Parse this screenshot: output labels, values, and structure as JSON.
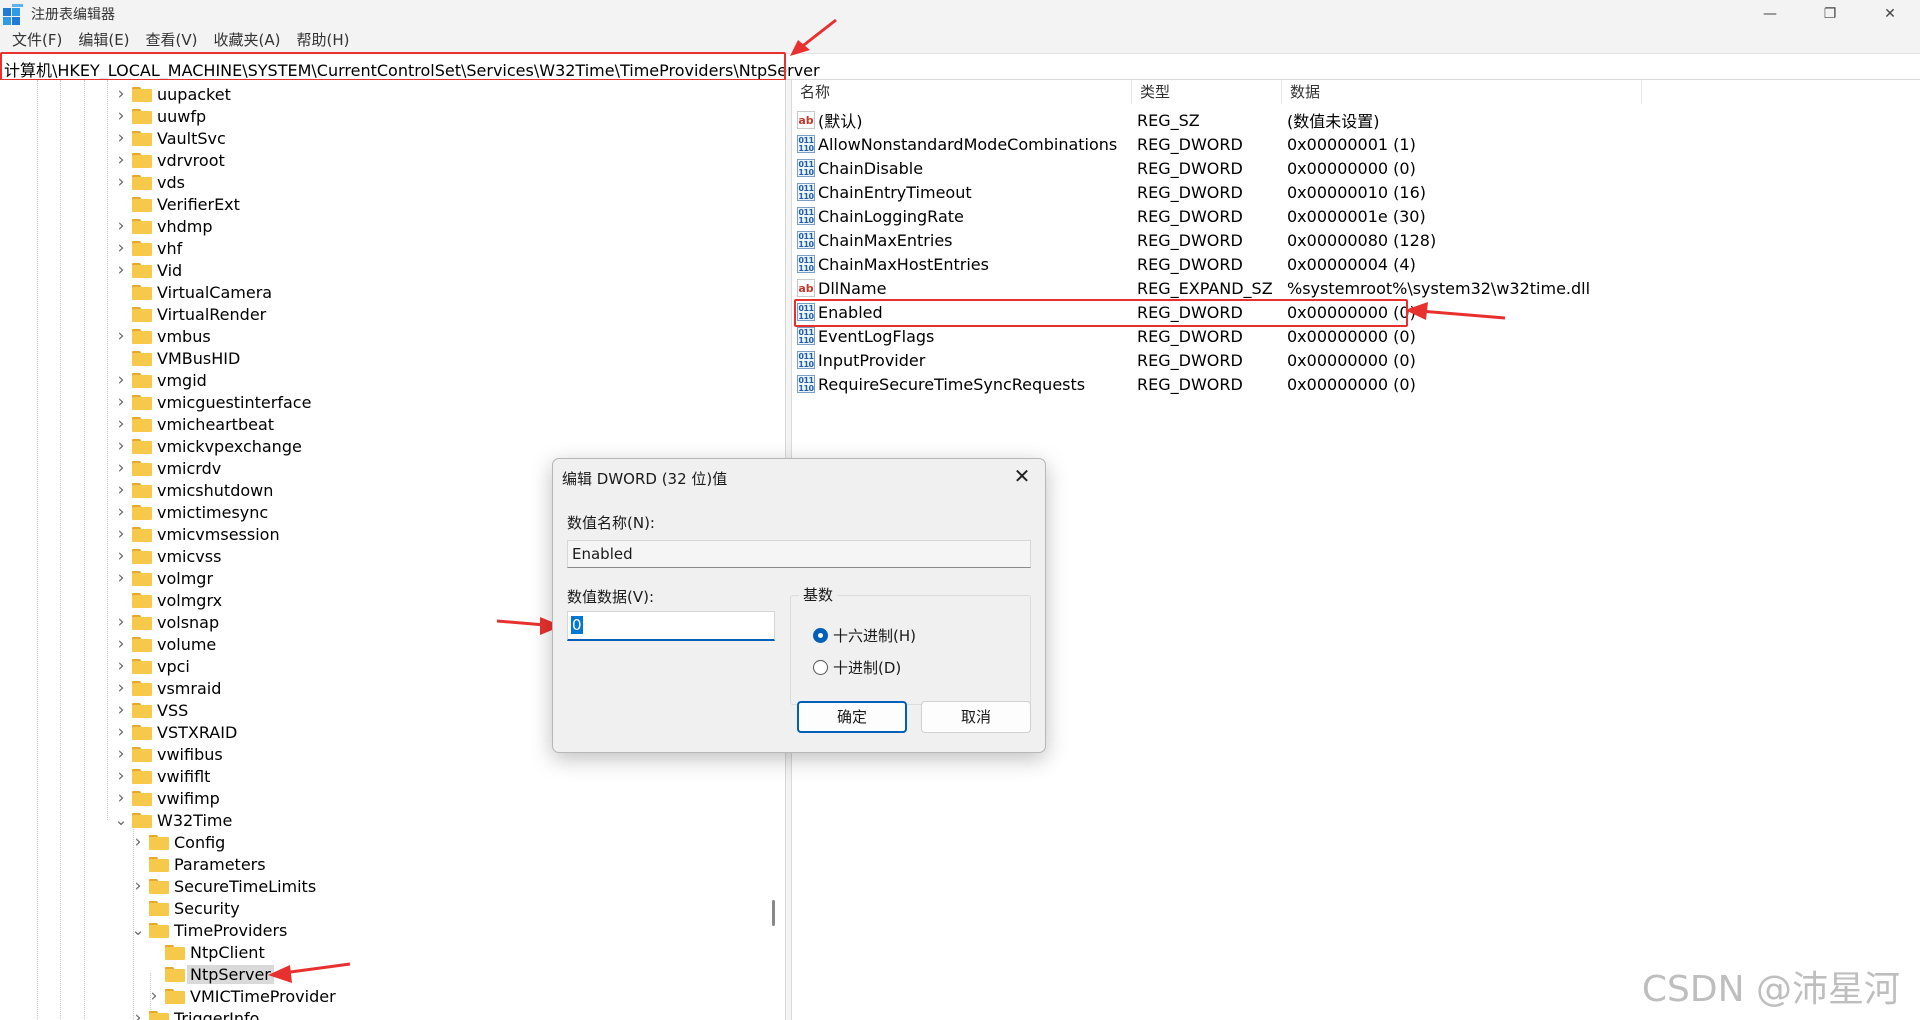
{
  "window": {
    "title": "注册表编辑器",
    "controls": {
      "minimize": "—",
      "restore": "❐",
      "close": "✕"
    }
  },
  "menu": [
    "文件(F)",
    "编辑(E)",
    "查看(V)",
    "收藏夹(A)",
    "帮助(H)"
  ],
  "address": "计算机\\HKEY_LOCAL_MACHINE\\SYSTEM\\CurrentControlSet\\Services\\W32Time\\TimeProviders\\NtpServer",
  "tree": {
    "items": [
      {
        "label": "uupacket",
        "level": 0,
        "expander": "collapsed"
      },
      {
        "label": "uuwfp",
        "level": 0,
        "expander": "collapsed"
      },
      {
        "label": "VaultSvc",
        "level": 0,
        "expander": "collapsed"
      },
      {
        "label": "vdrvroot",
        "level": 0,
        "expander": "collapsed"
      },
      {
        "label": "vds",
        "level": 0,
        "expander": "collapsed"
      },
      {
        "label": "VerifierExt",
        "level": 0,
        "expander": "none"
      },
      {
        "label": "vhdmp",
        "level": 0,
        "expander": "collapsed"
      },
      {
        "label": "vhf",
        "level": 0,
        "expander": "collapsed"
      },
      {
        "label": "Vid",
        "level": 0,
        "expander": "collapsed"
      },
      {
        "label": "VirtualCamera",
        "level": 0,
        "expander": "none"
      },
      {
        "label": "VirtualRender",
        "level": 0,
        "expander": "none"
      },
      {
        "label": "vmbus",
        "level": 0,
        "expander": "collapsed"
      },
      {
        "label": "VMBusHID",
        "level": 0,
        "expander": "none"
      },
      {
        "label": "vmgid",
        "level": 0,
        "expander": "collapsed"
      },
      {
        "label": "vmicguestinterface",
        "level": 0,
        "expander": "collapsed"
      },
      {
        "label": "vmicheartbeat",
        "level": 0,
        "expander": "collapsed"
      },
      {
        "label": "vmickvpexchange",
        "level": 0,
        "expander": "collapsed"
      },
      {
        "label": "vmicrdv",
        "level": 0,
        "expander": "collapsed"
      },
      {
        "label": "vmicshutdown",
        "level": 0,
        "expander": "collapsed"
      },
      {
        "label": "vmictimesync",
        "level": 0,
        "expander": "collapsed"
      },
      {
        "label": "vmicvmsession",
        "level": 0,
        "expander": "collapsed"
      },
      {
        "label": "vmicvss",
        "level": 0,
        "expander": "collapsed"
      },
      {
        "label": "volmgr",
        "level": 0,
        "expander": "collapsed"
      },
      {
        "label": "volmgrx",
        "level": 0,
        "expander": "none"
      },
      {
        "label": "volsnap",
        "level": 0,
        "expander": "collapsed"
      },
      {
        "label": "volume",
        "level": 0,
        "expander": "collapsed"
      },
      {
        "label": "vpci",
        "level": 0,
        "expander": "collapsed"
      },
      {
        "label": "vsmraid",
        "level": 0,
        "expander": "collapsed"
      },
      {
        "label": "VSS",
        "level": 0,
        "expander": "collapsed"
      },
      {
        "label": "VSTXRAID",
        "level": 0,
        "expander": "collapsed"
      },
      {
        "label": "vwifibus",
        "level": 0,
        "expander": "collapsed"
      },
      {
        "label": "vwififlt",
        "level": 0,
        "expander": "collapsed"
      },
      {
        "label": "vwifimp",
        "level": 0,
        "expander": "collapsed"
      },
      {
        "label": "W32Time",
        "level": 0,
        "expander": "expanded"
      },
      {
        "label": "Config",
        "level": 1,
        "expander": "collapsed"
      },
      {
        "label": "Parameters",
        "level": 1,
        "expander": "none"
      },
      {
        "label": "SecureTimeLimits",
        "level": 1,
        "expander": "collapsed"
      },
      {
        "label": "Security",
        "level": 1,
        "expander": "none"
      },
      {
        "label": "TimeProviders",
        "level": 1,
        "expander": "expanded"
      },
      {
        "label": "NtpClient",
        "level": 2,
        "expander": "none"
      },
      {
        "label": "NtpServer",
        "level": 2,
        "expander": "none",
        "selected": true
      },
      {
        "label": "VMICTimeProvider",
        "level": 2,
        "expander": "collapsed"
      },
      {
        "label": "TriggerInfo",
        "level": 1,
        "expander": "collapsed"
      }
    ]
  },
  "list": {
    "headers": {
      "name": "名称",
      "type": "类型",
      "data": "数据"
    },
    "rows": [
      {
        "icon": "ab",
        "name": "(默认)",
        "type": "REG_SZ",
        "data": "(数值未设置)"
      },
      {
        "icon": "dword",
        "name": "AllowNonstandardModeCombinations",
        "type": "REG_DWORD",
        "data": "0x00000001 (1)"
      },
      {
        "icon": "dword",
        "name": "ChainDisable",
        "type": "REG_DWORD",
        "data": "0x00000000 (0)"
      },
      {
        "icon": "dword",
        "name": "ChainEntryTimeout",
        "type": "REG_DWORD",
        "data": "0x00000010 (16)"
      },
      {
        "icon": "dword",
        "name": "ChainLoggingRate",
        "type": "REG_DWORD",
        "data": "0x0000001e (30)"
      },
      {
        "icon": "dword",
        "name": "ChainMaxEntries",
        "type": "REG_DWORD",
        "data": "0x00000080 (128)"
      },
      {
        "icon": "dword",
        "name": "ChainMaxHostEntries",
        "type": "REG_DWORD",
        "data": "0x00000004 (4)"
      },
      {
        "icon": "ab",
        "name": "DllName",
        "type": "REG_EXPAND_SZ",
        "data": "%systemroot%\\system32\\w32time.dll"
      },
      {
        "icon": "dword",
        "name": "Enabled",
        "type": "REG_DWORD",
        "data": "0x00000000 (0)",
        "highlighted": true
      },
      {
        "icon": "dword",
        "name": "EventLogFlags",
        "type": "REG_DWORD",
        "data": "0x00000000 (0)"
      },
      {
        "icon": "dword",
        "name": "InputProvider",
        "type": "REG_DWORD",
        "data": "0x00000000 (0)"
      },
      {
        "icon": "dword",
        "name": "RequireSecureTimeSyncRequests",
        "type": "REG_DWORD",
        "data": "0x00000000 (0)"
      }
    ]
  },
  "dialog": {
    "title": "编辑 DWORD (32 位)值",
    "close": "✕",
    "name_label": "数值名称(N):",
    "name_value": "Enabled",
    "data_label": "数值数据(V):",
    "data_value": "0",
    "base_label": "基数",
    "radio_hex": "十六进制(H)",
    "radio_dec": "十进制(D)",
    "selected_base": "hex",
    "ok": "确定",
    "cancel": "取消"
  },
  "watermark": "CSDN @沛星河",
  "colors": {
    "annotation": "#e8312f",
    "accent": "#005fb8",
    "folder": "#f6c94a"
  }
}
